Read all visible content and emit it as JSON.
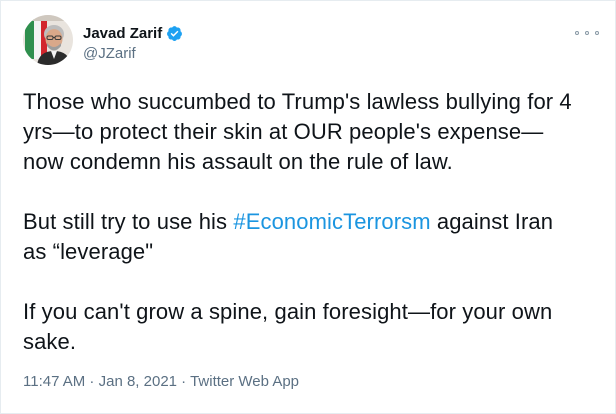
{
  "user": {
    "display_name": "Javad Zarif",
    "handle": "@JZarif",
    "verified_icon": "verified-badge-icon",
    "avatar_icon": "profile-photo"
  },
  "tweet": {
    "line1": "Those who succumbed to Trump's lawless bullying for 4",
    "line2": "yrs—to protect their skin at OUR people's expense—",
    "line3": "now condemn his assault on the rule of law.",
    "line4_pre": "But still try to use his ",
    "hashtag": "#EconomicTerrorsm",
    "line4_post": " against Iran",
    "line5": "as “leverage\"",
    "line6": "If you can't grow a spine, gain foresight—for your own",
    "line7": "sake."
  },
  "meta": {
    "time": "11:47 AM",
    "date": "Jan 8, 2021",
    "source": "Twitter Web App",
    "separator": " · "
  },
  "colors": {
    "link": "#1b95e0",
    "secondary_text": "#5b7083",
    "verified": "#1da1f2"
  }
}
